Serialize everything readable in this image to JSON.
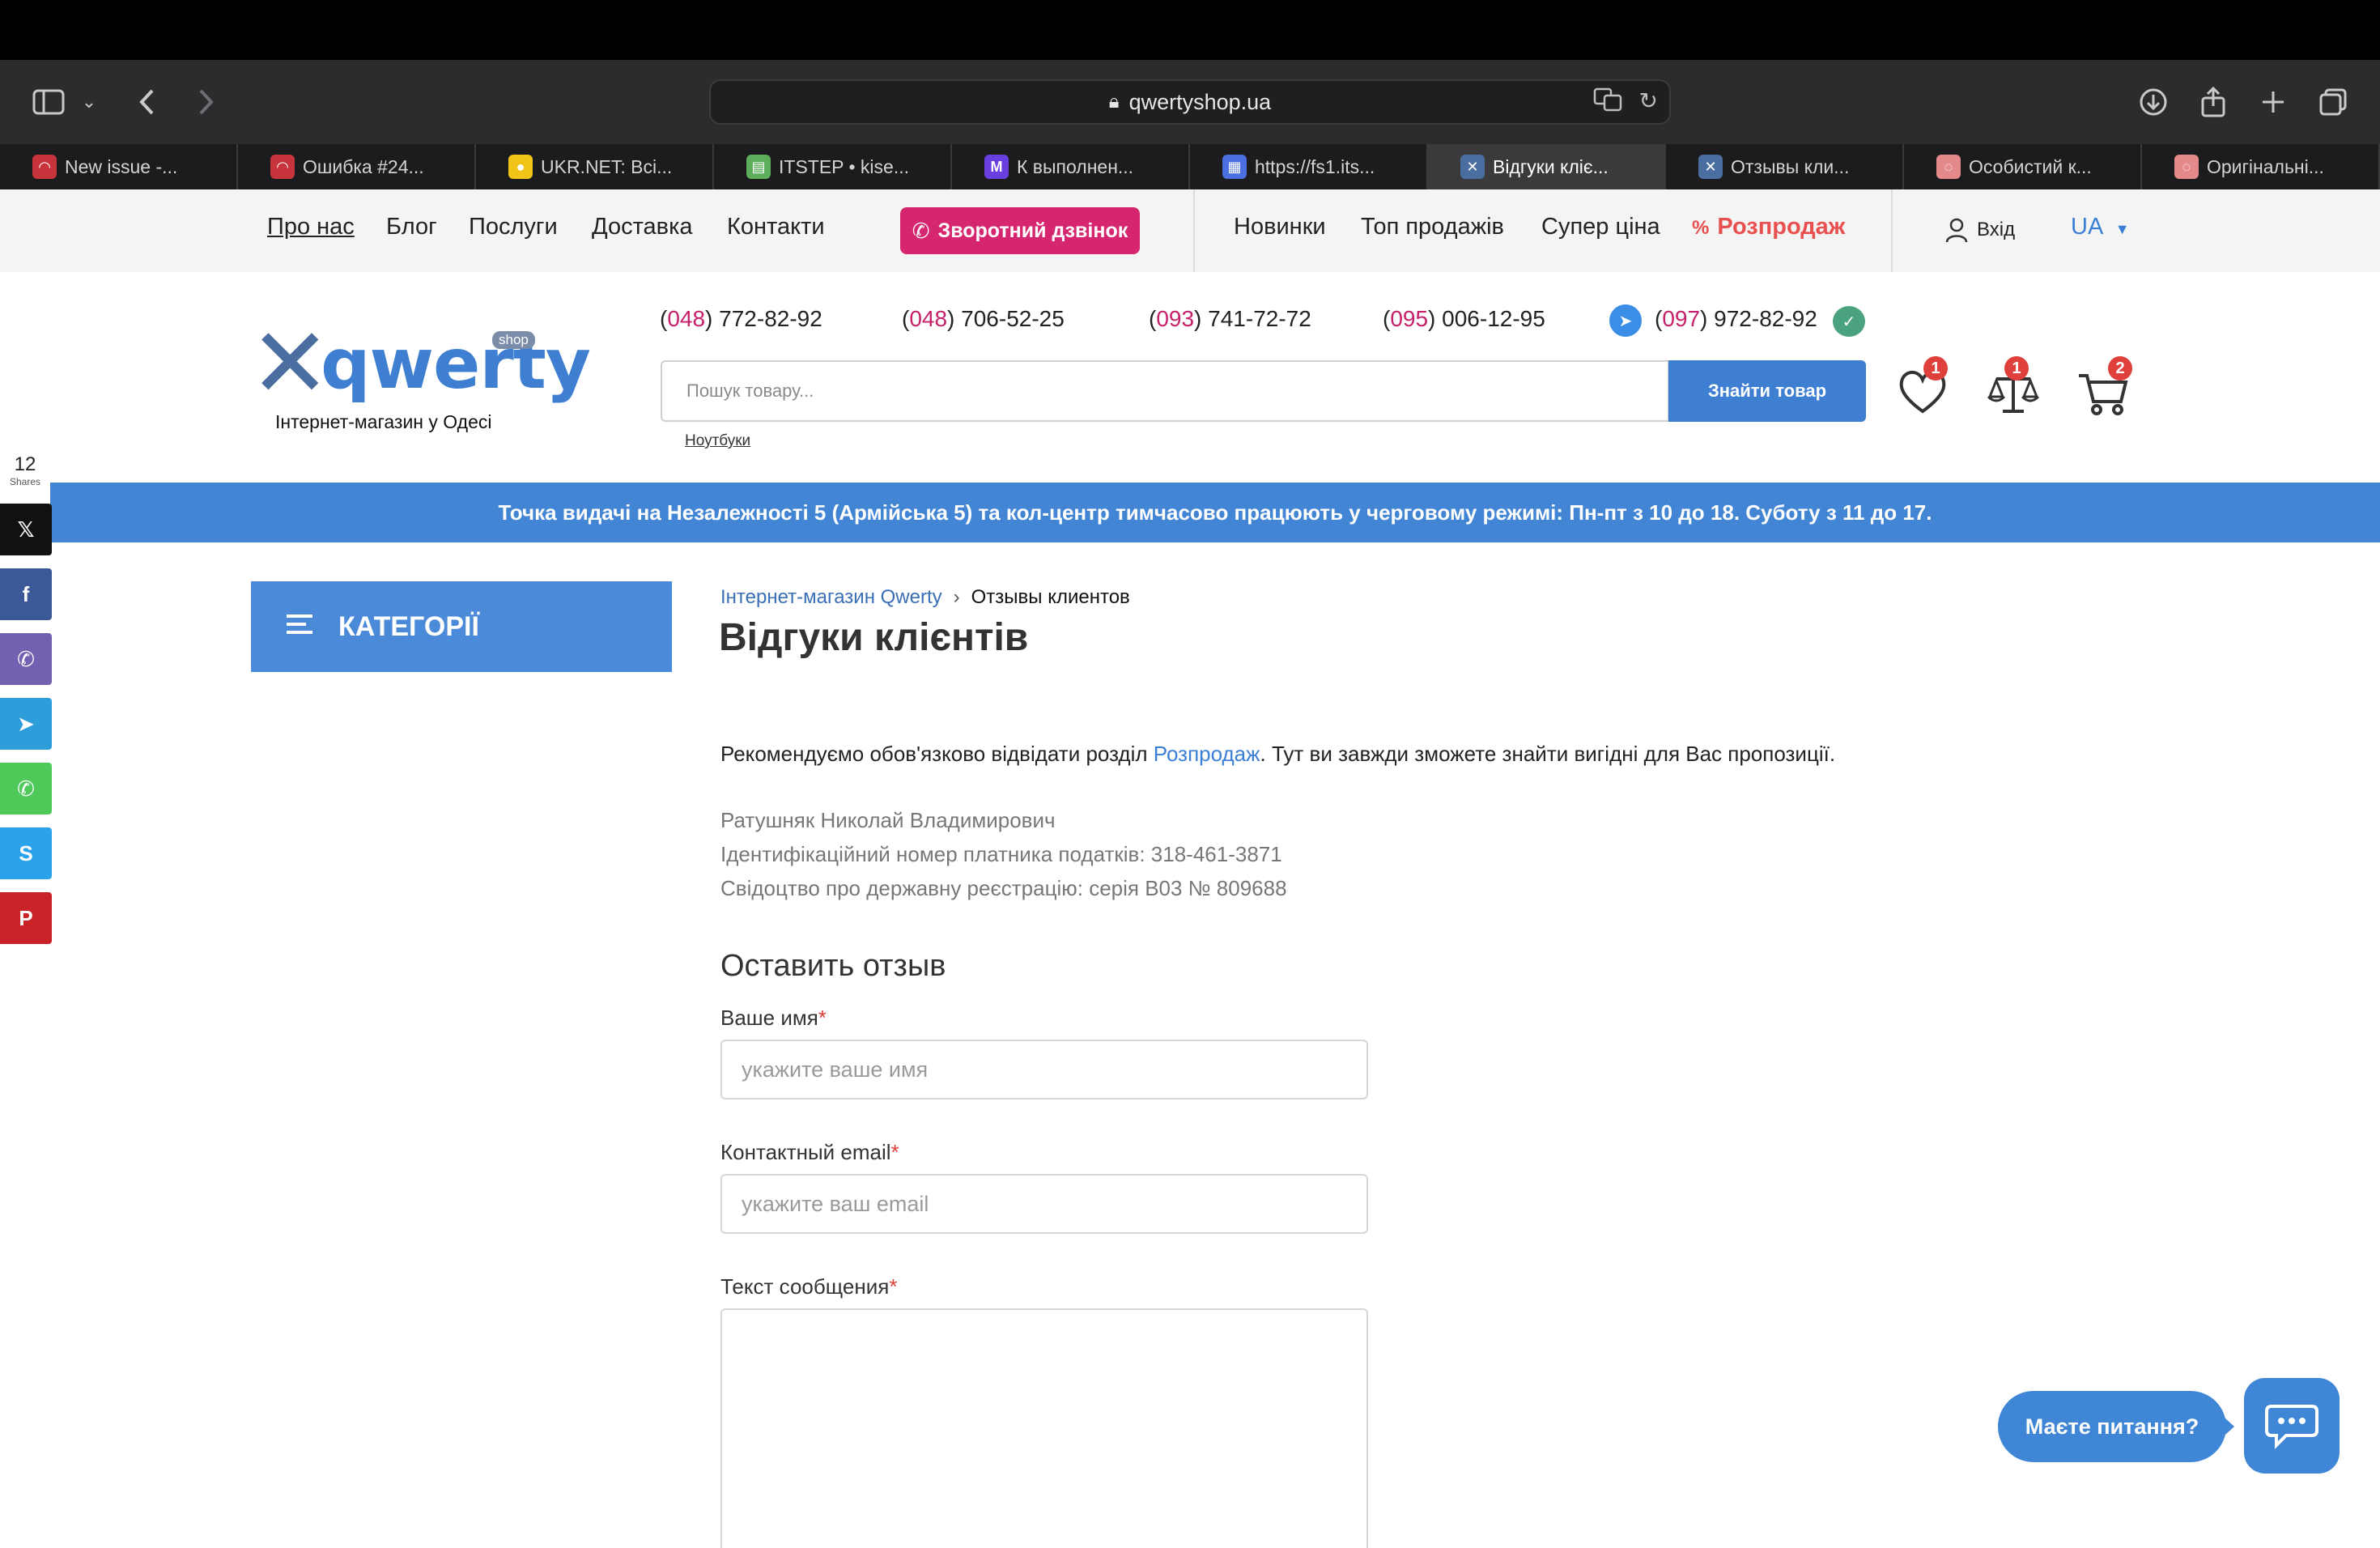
{
  "browser": {
    "url": "qwertyshop.ua",
    "tabs": [
      {
        "label": "New issue -...",
        "fav_color": "#c8343b",
        "fav_text": "◠",
        "active": false
      },
      {
        "label": "Ошибка #24...",
        "fav_color": "#c8343b",
        "fav_text": "◠",
        "active": false
      },
      {
        "label": "UKR.NET: Всі...",
        "fav_color": "#f2c417",
        "fav_text": "●",
        "active": false
      },
      {
        "label": "ITSTEP • kise...",
        "fav_color": "#5cae5a",
        "fav_text": "▤",
        "active": false
      },
      {
        "label": "К выполнен...",
        "fav_color": "#6a3fe0",
        "fav_text": "M",
        "active": false
      },
      {
        "label": "https://fs1.its...",
        "fav_color": "#4a6fe0",
        "fav_text": "▦",
        "active": false
      },
      {
        "label": "Відгуки кліє...",
        "fav_color": "#4a6ea0",
        "fav_text": "✕",
        "active": true
      },
      {
        "label": "Отзывы кли...",
        "fav_color": "#4a6ea0",
        "fav_text": "✕",
        "active": false
      },
      {
        "label": "Особистий к...",
        "fav_color": "#e58a8a",
        "fav_text": "◌",
        "active": false
      },
      {
        "label": "Оригінальні...",
        "fav_color": "#e58a8a",
        "fav_text": "◌",
        "active": false
      }
    ]
  },
  "nav": {
    "about": "Про нас",
    "blog": "Блог",
    "services": "Послуги",
    "delivery": "Доставка",
    "contacts": "Контакти",
    "callback": "Зворотний дзвінок",
    "new": "Новинки",
    "top": "Топ продажів",
    "super": "Супер ціна",
    "sale": "Розпродаж",
    "login": "Вхід",
    "lang": "UA"
  },
  "header": {
    "logo_word": "qwerty",
    "logo_shop": "shop",
    "tagline": "Інтернет-магазин у Одесі",
    "phones": [
      {
        "code": "048",
        "rest": " 772-82-92"
      },
      {
        "code": "048",
        "rest": " 706-52-25"
      },
      {
        "code": "093",
        "rest": " 741-72-72"
      },
      {
        "code": "095",
        "rest": " 006-12-95"
      },
      {
        "code": "097",
        "rest": " 972-82-92"
      }
    ],
    "search_placeholder": "Пошук товару...",
    "search_button": "Знайти товар",
    "hint": "Ноутбуки",
    "wishlist_count": "1",
    "compare_count": "1",
    "cart_count": "2"
  },
  "banner": "Точка видачі на Незалежності 5 (Армійська 5) та кол-центр тимчасово працюють у черговому режимі: Пн-пт з 10 до 18. Суботу з 11 до 17.",
  "share": {
    "count": "12",
    "label": "Shares",
    "buttons": [
      {
        "name": "x",
        "icon": "𝕏",
        "color": "#111111"
      },
      {
        "name": "facebook",
        "icon": "f",
        "color": "#3b5998"
      },
      {
        "name": "viber",
        "icon": "✆",
        "color": "#7360b1"
      },
      {
        "name": "telegram",
        "icon": "➤",
        "color": "#2d9ed9"
      },
      {
        "name": "whatsapp",
        "icon": "✆",
        "color": "#4fc95a"
      },
      {
        "name": "skype",
        "icon": "S",
        "color": "#2aa3ea"
      },
      {
        "name": "pinterest",
        "icon": "P",
        "color": "#c92228"
      }
    ]
  },
  "sidebar": {
    "categories": "КАТЕГОРІЇ"
  },
  "content": {
    "breadcrumb_home": "Інтернет-магазин Qwerty",
    "breadcrumb_current": "Отзывы клиентов",
    "title": "Відгуки клієнтів",
    "reco_before": "Рекомендуємо обов'язково відвідати розділ ",
    "reco_link": "Розпродаж",
    "reco_after": ". Тут ви завжди зможете знайти вигідні для Вас пропозиції.",
    "legal": [
      "Ратушняк Николай Владимирович",
      "Ідентифікаційний номер платника податків: 318-461-3871",
      "Свідоцтво про державну реєстрацію: серія В03 № 809688"
    ],
    "form_title": "Оставить отзыв",
    "name_label": "Ваше имя",
    "name_placeholder": "укажите ваше имя",
    "email_label": "Контактный email",
    "email_placeholder": "укажите ваш email",
    "message_label": "Текст сообщения",
    "required_mark": "*"
  },
  "chat": {
    "bubble": "Маєте питання?"
  }
}
